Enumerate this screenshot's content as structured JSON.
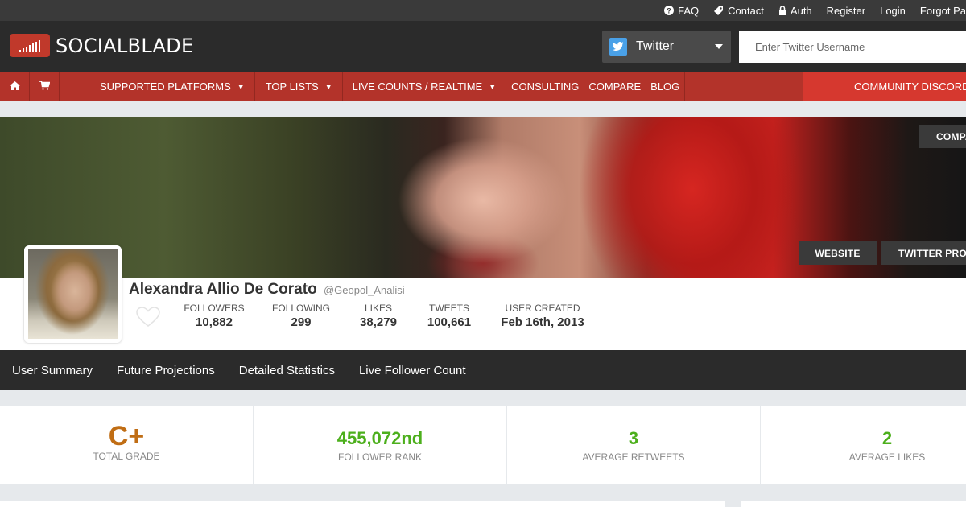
{
  "topbar": {
    "links": [
      {
        "label": "FAQ",
        "icon": "question-circle-icon"
      },
      {
        "label": "Contact",
        "icon": "tag-icon"
      },
      {
        "label": "Auth",
        "icon": "lock-icon"
      },
      {
        "label": "Register"
      },
      {
        "label": "Login"
      },
      {
        "label": "Forgot Pa"
      }
    ]
  },
  "header": {
    "logo_text": "SOCIALBLADE",
    "platform": "Twitter",
    "search_placeholder": "Enter Twitter Username"
  },
  "nav": {
    "items": [
      {
        "label": "SUPPORTED PLATFORMS",
        "dropdown": "▼"
      },
      {
        "label": "TOP LISTS",
        "dropdown": "▼"
      },
      {
        "label": "LIVE COUNTS / REALTIME",
        "dropdown": "▼"
      },
      {
        "label": "CONSULTING"
      },
      {
        "label": "COMPARE"
      },
      {
        "label": "BLOG"
      }
    ],
    "discord": "COMMUNITY DISCORD"
  },
  "banner": {
    "compare_button": "COMPA",
    "website_button": "WEBSITE",
    "profile_button": "TWITTER PROI"
  },
  "profile": {
    "name": "Alexandra Allio De Corato",
    "handle": "@Geopol_Analisi",
    "stats": [
      {
        "label": "FOLLOWERS",
        "value": "10,882"
      },
      {
        "label": "FOLLOWING",
        "value": "299"
      },
      {
        "label": "LIKES",
        "value": "38,279"
      },
      {
        "label": "TWEETS",
        "value": "100,661"
      },
      {
        "label": "USER CREATED",
        "value": "Feb 16th, 2013"
      }
    ]
  },
  "subnav": {
    "items": [
      "User Summary",
      "Future Projections",
      "Detailed Statistics",
      "Live Follower Count"
    ]
  },
  "summary": {
    "grade": {
      "value": "C+",
      "label": "TOTAL GRADE",
      "color": "#c06d14"
    },
    "rank": {
      "value": "455,072nd",
      "label": "FOLLOWER RANK",
      "color": "#4caf1c"
    },
    "retweets": {
      "value": "3",
      "label": "AVERAGE RETWEETS",
      "color": "#4caf1c"
    },
    "likes": {
      "value": "2",
      "label": "AVERAGE LIKES",
      "color": "#4caf1c"
    }
  },
  "colors": {
    "nav_red": "#b3332a",
    "discord_red": "#d6382f",
    "header_dark": "#2b2b2b"
  }
}
